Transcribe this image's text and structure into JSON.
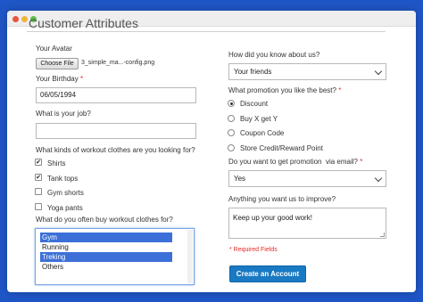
{
  "page": {
    "title": "Customer Attributes"
  },
  "left": {
    "avatar": {
      "label": "Your Avatar",
      "button_label": "Choose File",
      "file_name": "3_simple_ma...-config.png"
    },
    "birthday": {
      "label": "Your Birthday",
      "required_mark": "*",
      "value": "06/05/1994"
    },
    "job": {
      "label": "What is your job?",
      "value": ""
    },
    "clothes": {
      "label": "What kinds of workout clothes are you looking for?",
      "options": [
        {
          "label": "Shirts",
          "checked": true,
          "check_mark": "✔"
        },
        {
          "label": "Tank tops",
          "checked": true,
          "check_mark": "✔"
        },
        {
          "label": "Gym shorts",
          "checked": false,
          "check_mark": ""
        },
        {
          "label": "Yoga pants",
          "checked": false,
          "check_mark": ""
        }
      ]
    },
    "buy_where": {
      "label": "What do you often buy workout clothes for?",
      "options": [
        {
          "label": "Gym",
          "selected": true
        },
        {
          "label": "Running",
          "selected": false
        },
        {
          "label": "Treking",
          "selected": true
        },
        {
          "label": "Others",
          "selected": false
        }
      ]
    }
  },
  "right": {
    "heard": {
      "label": "How did you know about us?",
      "value": "Your friends"
    },
    "promotion": {
      "label": "What promotion you like the best?",
      "required_mark": "*",
      "options": [
        {
          "label": "Discount",
          "selected": true
        },
        {
          "label": "Buy X get Y",
          "selected": false
        },
        {
          "label": "Coupon Code",
          "selected": false
        },
        {
          "label": "Store Credit/Reward Point",
          "selected": false
        }
      ]
    },
    "email_promo": {
      "label": "Do you want to get promotion  via email?",
      "required_mark": "*",
      "value": "Yes"
    },
    "improve": {
      "label": "Anything you want us to improve?",
      "value": "Keep up your good work!"
    },
    "required_note": "* Required Fields",
    "submit_label": "Create an Account"
  },
  "colors": {
    "background": "#1f56c7",
    "button": "#1979c3",
    "required": "#e02b27",
    "selection": "#3c70d8"
  }
}
